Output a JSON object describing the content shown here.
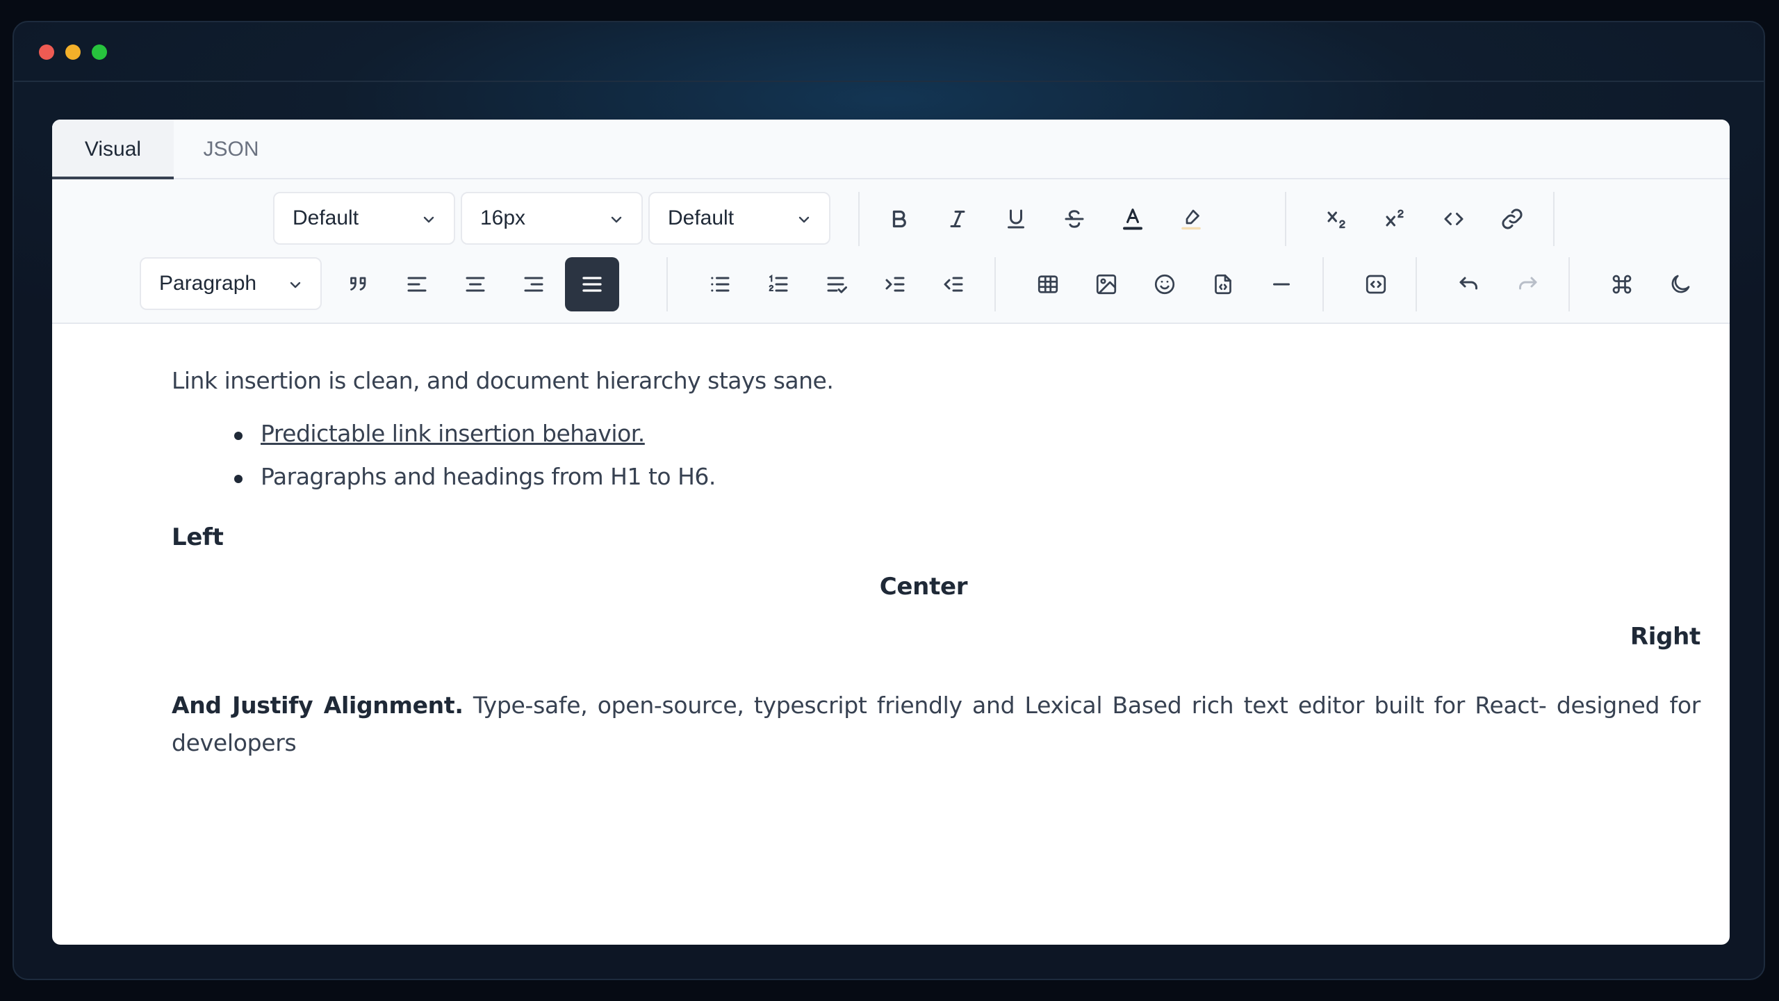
{
  "window": {
    "controls": [
      "close",
      "minimize",
      "maximize"
    ]
  },
  "tabs": [
    {
      "label": "Visual",
      "active": true
    },
    {
      "label": "JSON",
      "active": false
    }
  ],
  "toolbar": {
    "font_family": "Default",
    "font_size": "16px",
    "line_height": "Default",
    "block_type": "Paragraph",
    "row1_icons": [
      "bold-icon",
      "italic-icon",
      "underline-icon",
      "strikethrough-icon",
      "text-color-icon",
      "highlight-icon",
      "subscript-icon",
      "superscript-icon",
      "code-icon",
      "link-icon"
    ],
    "row2_icons": [
      "quote-icon",
      "align-left-icon",
      "align-center-icon",
      "align-right-icon",
      "align-justify-icon",
      "bullet-list-icon",
      "numbered-list-icon",
      "check-list-icon",
      "indent-icon",
      "outdent-icon",
      "table-icon",
      "image-icon",
      "emoji-icon",
      "file-icon",
      "horizontal-rule-icon",
      "embed-icon",
      "undo-icon",
      "redo-icon",
      "command-icon",
      "theme-toggle-icon"
    ],
    "active_alignment": "justify",
    "active_color": "#2b3442"
  },
  "content": {
    "paragraph1": "Link insertion is clean, and document hierarchy stays sane.",
    "list_items": [
      {
        "text": "Predictable link insertion behavior.",
        "link": true
      },
      {
        "text": "Paragraphs and headings from H1 to H6.",
        "link": false
      }
    ],
    "heading_left": "Left",
    "heading_center": "Center",
    "heading_right": "Right",
    "justify_bold": "And Justify Alignment.",
    "justify_text": " Type-safe, open-source, typescript friendly and Lexical Based rich text editor built for React- designed for developers"
  }
}
